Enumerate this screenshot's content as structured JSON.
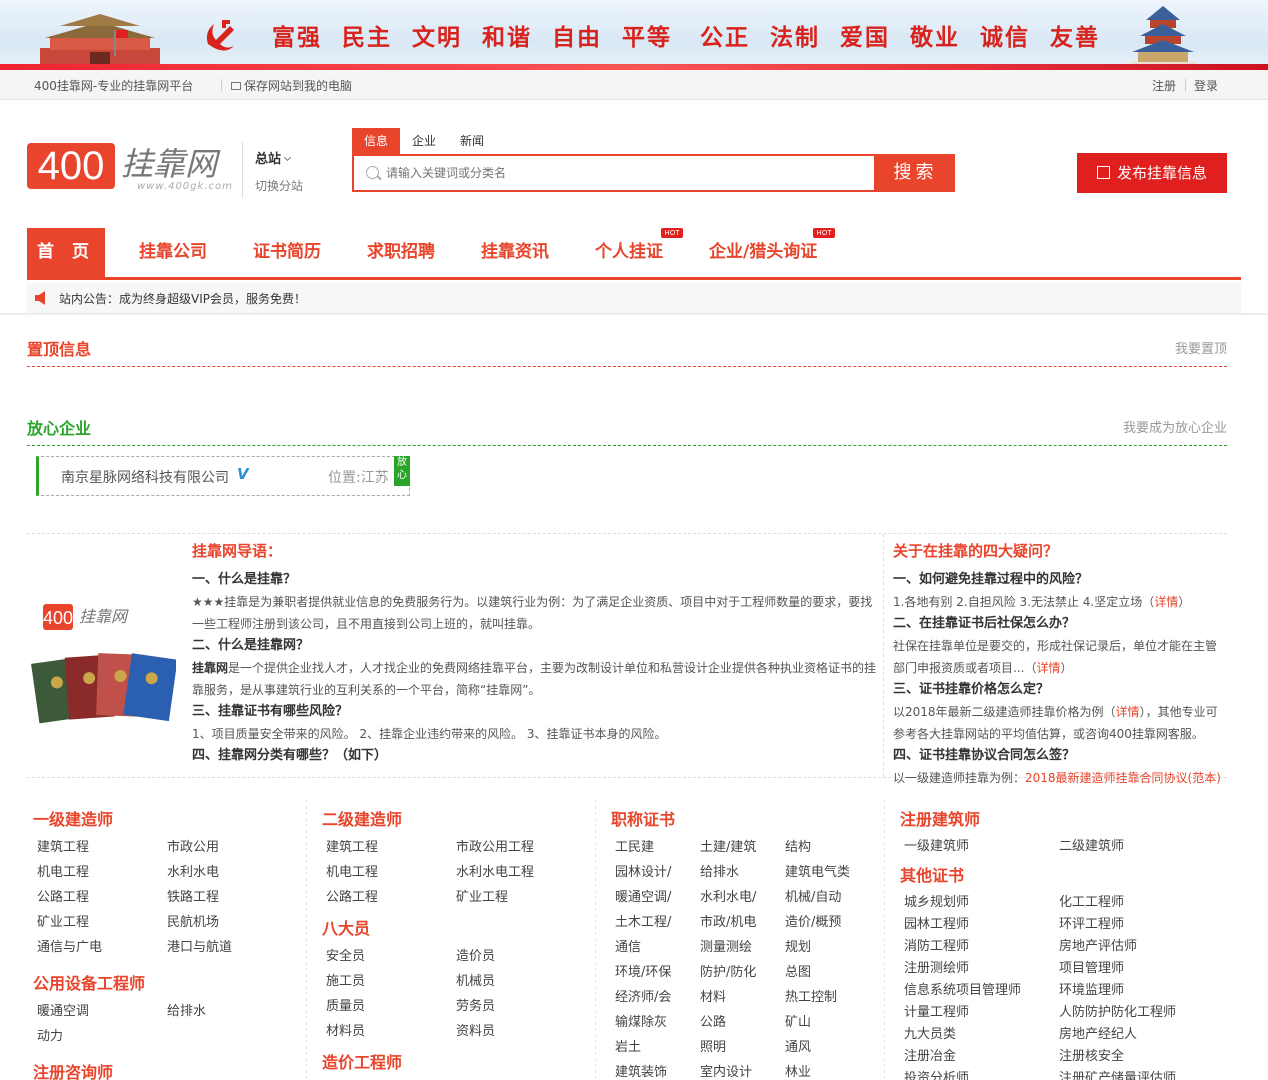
{
  "banner": {
    "slogan_left": "富强 民主 文明 和谐 自由 平等",
    "slogan_right": "公正 法制 爱国 敬业 诚信 友善"
  },
  "topbar": {
    "site_name": "400挂靠网-专业的挂靠网平台",
    "save_label": "保存网站到我的电脑",
    "register": "注册",
    "login": "登录"
  },
  "logo": {
    "number": "400",
    "text": "挂靠网",
    "url": "www.400gk.com"
  },
  "station": {
    "main": "总站",
    "switch": "切换分站"
  },
  "search": {
    "tabs": [
      "信息",
      "企业",
      "新闻"
    ],
    "active_tab": "信息",
    "placeholder": "请输入关键词或分类名",
    "button": "搜索"
  },
  "publish_button": "发布挂靠信息",
  "nav": {
    "items": [
      {
        "label": "首 页",
        "hot": false
      },
      {
        "label": "挂靠公司",
        "hot": false
      },
      {
        "label": "证书简历",
        "hot": false
      },
      {
        "label": "求职招聘",
        "hot": false
      },
      {
        "label": "挂靠资讯",
        "hot": false
      },
      {
        "label": "个人挂证",
        "hot": true
      },
      {
        "label": "企业/猎头询证",
        "hot": true
      }
    ],
    "hot_label": "HOT"
  },
  "notice": {
    "label": "站内公告：",
    "text": "成为终身超级VIP会员，服务免费！"
  },
  "top_section": {
    "title": "置顶信息",
    "link": "我要置顶"
  },
  "trust_section": {
    "title": "放心企业",
    "link": "我要成为放心企业"
  },
  "enterprise": {
    "name": "南京星脉网络科技有限公司",
    "verified": "V",
    "location": "位置:江苏",
    "badge": "放心"
  },
  "guide": {
    "title": "挂靠网导语：",
    "q1": "一、什么是挂靠？",
    "a1": "★★★挂靠是为兼职者提供就业信息的免费服务行为。以建筑行业为例：为了满足企业资质、项目中对于工程师数量的要求，要找一些工程师注册到该公司，且不用直接到公司上班的，就叫挂靠。",
    "q2": "二、什么是挂靠网？",
    "a2_bold": "挂靠网",
    "a2": "是一个提供企业找人才，人才找企业的免费网络挂靠平台，主要为改制设计单位和私营设计企业提供各种执业资格证书的挂靠服务，是从事建筑行业的互利关系的一个平台，简称“挂靠网”。",
    "q3": "三、挂靠证书有哪些风险？",
    "a3": "1、项目质量安全带来的风险。 2、挂靠企业违约带来的风险。 3、挂靠证书本身的风险。",
    "q4": "四、挂靠网分类有哪些？（如下）"
  },
  "faq": {
    "title": "关于在挂靠的四大疑问？",
    "q1": "一、如何避免挂靠过程中的风险？",
    "a1": "1.各地有别 2.自担风险 3.无法禁止 4.坚定立场（",
    "q2": "二、在挂靠证书后社保怎么办？",
    "a2": "社保在挂靠单位是要交的，形成社保记录后，单位才能在主管部门申报资质或者项目...（",
    "q3": "三、证书挂靠价格怎么定？",
    "a3_pre": "以2018年最新二级建造师挂靠价格为例（",
    "a3_post": "），其他专业可参考各大挂靠网站的平均值估算，或咨询400挂靠网客服。",
    "q4": "四、证书挂靠协议合同怎么签？",
    "a4": "以一级建造师挂靠为例：",
    "a4_link": "2018最新建造师挂靠合同协议(范本)",
    "detail": "详情",
    "close_paren": "）"
  },
  "categories": {
    "c1_h1": "一级建造师",
    "c1_l1": [
      "建筑工程",
      "市政公用",
      "机电工程",
      "水利水电",
      "公路工程",
      "铁路工程",
      "矿业工程",
      "民航机场",
      "通信与广电",
      "港口与航道"
    ],
    "c1_h2": "公用设备工程师",
    "c1_l2": [
      "暖通空调",
      "给排水",
      "动力"
    ],
    "c1_h3": "注册咨询师",
    "c2_h1": "二级建造师",
    "c2_l1": [
      "建筑工程",
      "市政公用工程",
      "机电工程",
      "水利水电工程",
      "公路工程",
      "矿业工程"
    ],
    "c2_h2": "八大员",
    "c2_l2": [
      "安全员",
      "造价员",
      "施工员",
      "机械员",
      "质量员",
      "劳务员",
      "材料员",
      "资料员"
    ],
    "c2_h3": "造价工程师",
    "c3_h1": "职称证书",
    "c3_l1": [
      "工民建",
      "土建/建筑",
      "结构",
      "园林设计/",
      "给排水",
      "建筑电气类",
      "暖通空调/",
      "水利水电/",
      "机械/自动",
      "土木工程/",
      "市政/机电",
      "造价/概预",
      "通信",
      "测量测绘",
      "规划",
      "环境/环保",
      "防护/防化",
      "总图",
      "经济师/会",
      "材料",
      "热工控制",
      "输煤除灰",
      "公路",
      "矿山",
      "岩土",
      "照明",
      "通风",
      "建筑装饰",
      "室内设计",
      "林业"
    ],
    "c4_h1": "注册建筑师",
    "c4_l1": [
      "一级建筑师",
      "二级建筑师"
    ],
    "c4_h2": "其他证书",
    "c4_l2": [
      "城乡规划师",
      "化工工程师",
      "园林工程师",
      "环评工程师",
      "消防工程师",
      "房地产评估师",
      "注册测绘师",
      "项目管理师",
      "信息系统项目管理师",
      "环境监理师",
      "计量工程师",
      "人防防护防化工程师",
      "九大员类",
      "房地产经纪人",
      "注册冶金",
      "注册核安全",
      "投资分析师",
      "注册矿产储量评估师"
    ]
  },
  "colors": {
    "accent": "#e8452c",
    "green": "#2aa52a",
    "publish": "#e01f1f"
  }
}
